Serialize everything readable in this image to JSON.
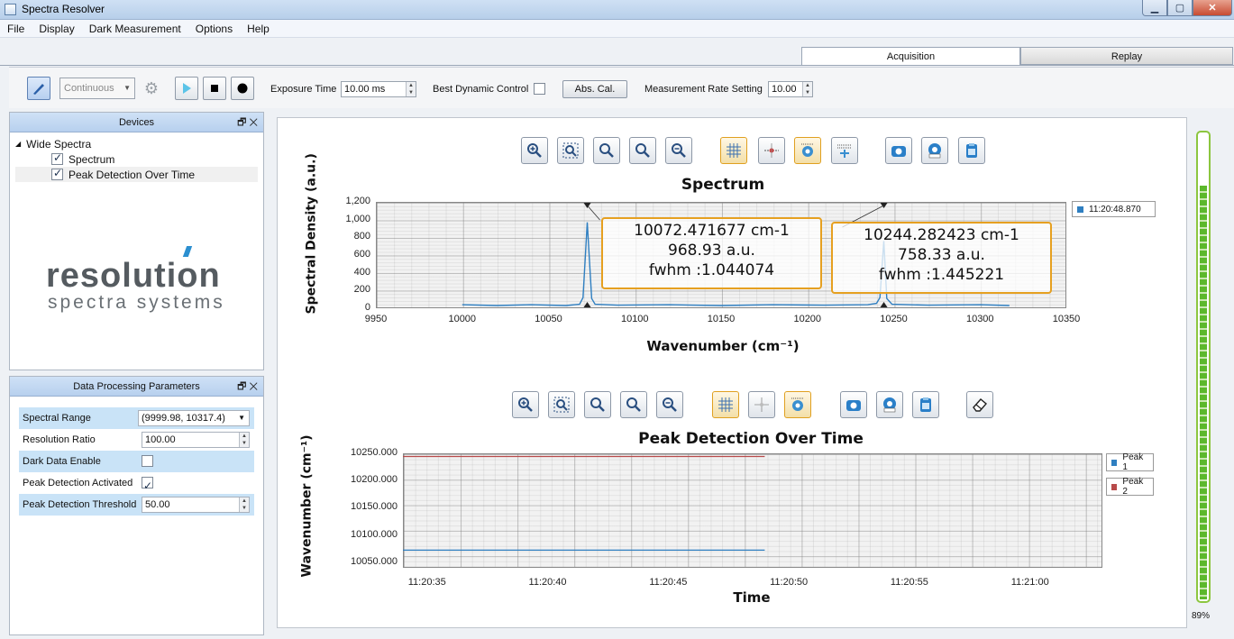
{
  "window": {
    "title": "Spectra Resolver"
  },
  "menu": [
    "File",
    "Display",
    "Dark Measurement",
    "Options",
    "Help"
  ],
  "tabs": {
    "acquisition": "Acquisition",
    "replay": "Replay"
  },
  "toolbar": {
    "mode": "Continuous",
    "exposure_label": "Exposure Time",
    "exposure_value": "10.00 ms",
    "best_dynamic_label": "Best Dynamic Control",
    "abs_cal_label": "Abs. Cal.",
    "rate_label": "Measurement Rate Setting",
    "rate_value": "10.00"
  },
  "devices_panel": {
    "title": "Devices",
    "root": "Wide Spectra",
    "items": [
      "Spectrum",
      "Peak Detection Over Time"
    ]
  },
  "logo": {
    "word": "resolution",
    "tagline": "spectra systems"
  },
  "params_panel": {
    "title": "Data Processing Parameters",
    "rows": [
      {
        "label": "Spectral Range",
        "value": "(9999.98, 10317.4)"
      },
      {
        "label": "Resolution Ratio",
        "value": "100.00"
      },
      {
        "label": "Dark Data Enable",
        "checked": false
      },
      {
        "label": "Peak Detection Activated",
        "checked": true
      },
      {
        "label": "Peak Detection Threshold",
        "value": "50.00"
      }
    ]
  },
  "spectrum_chart": {
    "annotations": [
      {
        "line1": "10072.471677 cm-1",
        "line2": "968.93 a.u.",
        "line3": "fwhm :1.044074"
      },
      {
        "line1": "10244.282423 cm-1",
        "line2": "758.33 a.u.",
        "line3": "fwhm :1.445221"
      }
    ]
  },
  "gauge": {
    "percent": 89,
    "label": "89%"
  },
  "colors": {
    "series_blue": "#2f7fc1",
    "series_red": "#b84a4a",
    "accent": "#e6a020",
    "gauge": "#5cb82c"
  },
  "chart_data": [
    {
      "type": "line",
      "title": "Spectrum",
      "xlabel": "Wavenumber (cm⁻¹)",
      "ylabel": "Spectral Density (a.u.)",
      "xlim": [
        9950,
        10350
      ],
      "ylim": [
        0,
        1200
      ],
      "x_ticks": [
        "9950",
        "10000",
        "10050",
        "10100",
        "10150",
        "10200",
        "10250",
        "10300",
        "10350"
      ],
      "y_ticks": [
        "0",
        "200",
        "400",
        "600",
        "800",
        "1,000",
        "1,200"
      ],
      "grid": true,
      "legend": "top-right",
      "series": [
        {
          "name": "11:20:48.870",
          "x": [
            10000,
            10020,
            10040,
            10060,
            10068,
            10070,
            10072.47,
            10075,
            10077,
            10090,
            10120,
            10150,
            10180,
            10210,
            10235,
            10240,
            10242,
            10244.28,
            10246,
            10249,
            10270,
            10300,
            10317
          ],
          "y": [
            40,
            30,
            40,
            30,
            45,
            120,
            968.93,
            110,
            45,
            35,
            40,
            30,
            40,
            35,
            40,
            55,
            120,
            758.33,
            110,
            45,
            35,
            40,
            30
          ]
        }
      ]
    },
    {
      "type": "line",
      "title": "Peak Detection Over Time",
      "xlabel": "Time",
      "ylabel": "Wavenumber (cm⁻¹)",
      "xlim": [
        "11:20:34",
        "11:21:03"
      ],
      "ylim": [
        10040,
        10250
      ],
      "x_ticks": [
        "11:20:35",
        "11:20:40",
        "11:20:45",
        "11:20:50",
        "11:20:55",
        "11:21:00"
      ],
      "y_ticks": [
        "10050.000",
        "10100.000",
        "10150.000",
        "10200.000",
        "10250.000"
      ],
      "grid": true,
      "legend": "right",
      "series": [
        {
          "name": "Peak 1",
          "x": [
            "11:20:34",
            "11:20:49"
          ],
          "y": [
            10072.47,
            10072.47
          ]
        },
        {
          "name": "Peak 2",
          "x": [
            "11:20:34",
            "11:20:49"
          ],
          "y": [
            10244.28,
            10244.28
          ]
        }
      ]
    }
  ]
}
